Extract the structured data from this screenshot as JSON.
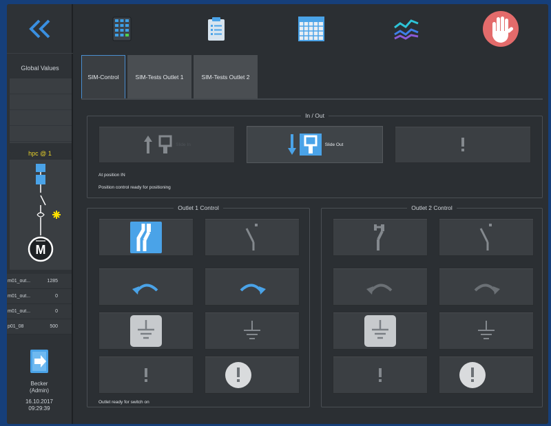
{
  "sidebar": {
    "global_values_title": "Global Values",
    "hpc_label": "hpc @ 1",
    "values": [
      {
        "name": "m01_out...",
        "value": "1285"
      },
      {
        "name": "m01_out...",
        "value": "0"
      },
      {
        "name": "m01_out...",
        "value": "0"
      },
      {
        "name": "p01_08",
        "value": "500"
      }
    ],
    "user_name": "Becker",
    "user_role": "(Admin)",
    "date": "16.10.2017",
    "time": "09:29:39"
  },
  "tabs": [
    {
      "label": "SIM-Control",
      "active": true
    },
    {
      "label": "SIM-Tests Outlet 1",
      "active": false
    },
    {
      "label": "SIM-Tests Outlet 2",
      "active": false
    }
  ],
  "inout": {
    "title": "In / Out",
    "slide_in_label": "Slide In",
    "slide_out_label": "Slide Out",
    "status_line1": "At position IN",
    "status_line2": "Position control ready for positioning"
  },
  "outlet1": {
    "title": "Outlet 1 Control",
    "status": "Outlet ready for switch on"
  },
  "outlet2": {
    "title": "Outlet 2 Control"
  },
  "colors": {
    "accent": "#4aa3e8",
    "stop": "#e36b6b",
    "warning": "#ffe100",
    "background": "#2b2f33"
  }
}
